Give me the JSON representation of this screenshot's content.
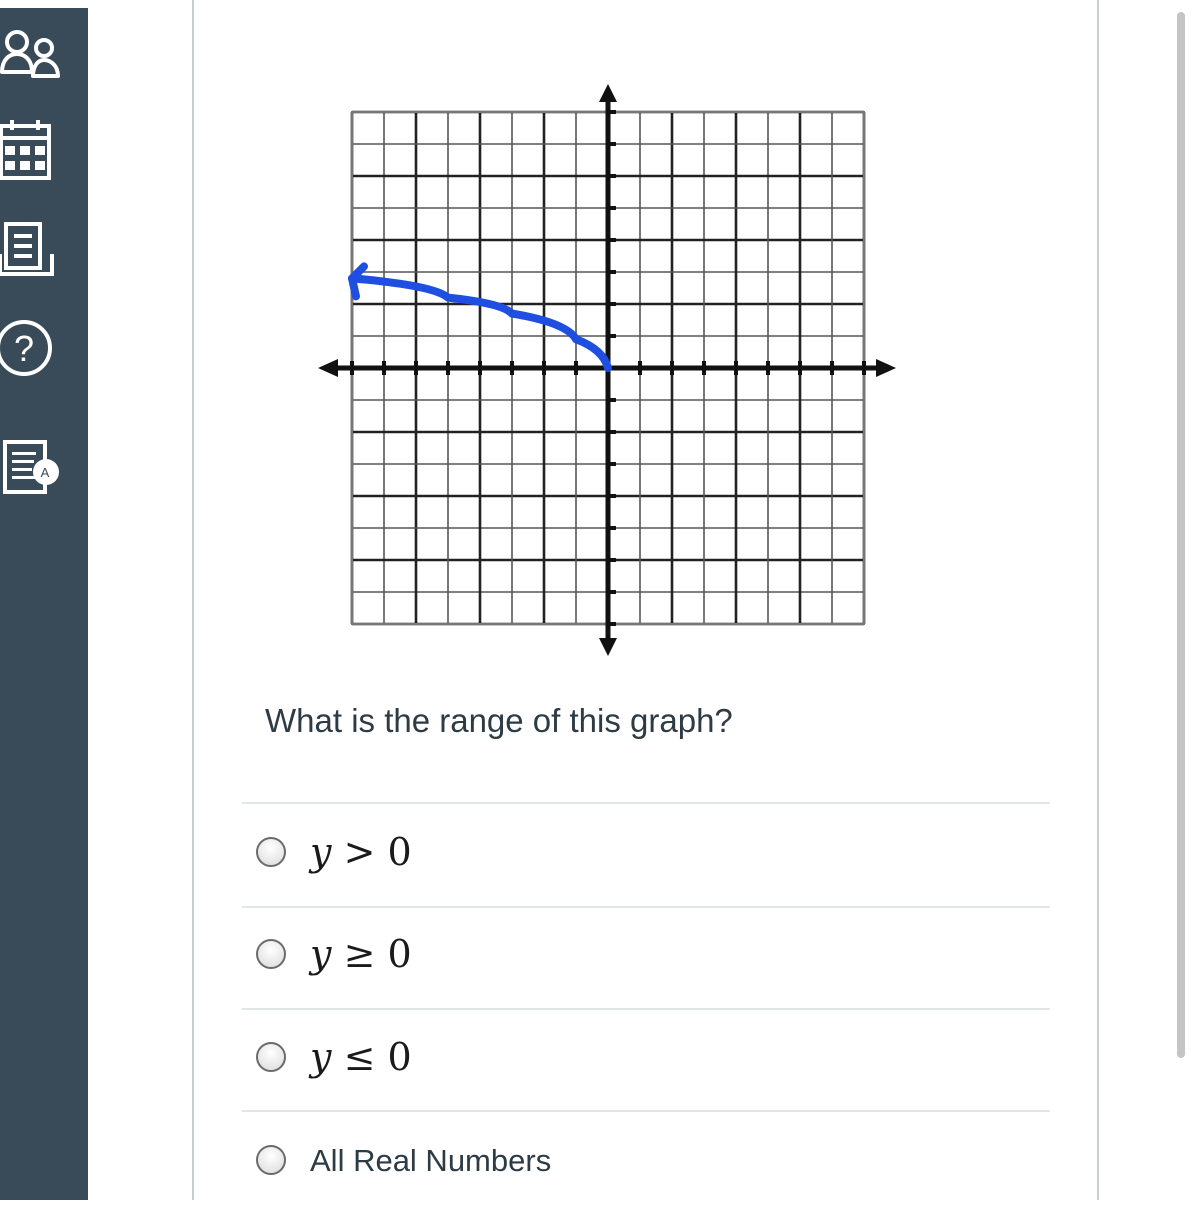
{
  "nav": {
    "items": [
      {
        "icon": "groups-icon"
      },
      {
        "icon": "calendar-icon"
      },
      {
        "icon": "inbox-icon"
      },
      {
        "icon": "help-icon"
      },
      {
        "icon": "assignment-icon"
      }
    ],
    "background": "#394b58"
  },
  "graph": {
    "grid_min": -8,
    "grid_max": 8,
    "curve_color": "#1f4fe0",
    "curve": {
      "type": "line",
      "points": [
        [
          0,
          0
        ],
        [
          -1,
          0.9
        ],
        [
          -3,
          1.7
        ],
        [
          -5,
          2.2
        ],
        [
          -8,
          2.8
        ]
      ],
      "arrow_end": "left"
    }
  },
  "question": {
    "prompt": "What is the range of this graph?"
  },
  "options": [
    {
      "var": "y",
      "op": ">",
      "val": "0"
    },
    {
      "var": "y",
      "op": "≥",
      "val": "0"
    },
    {
      "var": "y",
      "op": "≤",
      "val": "0"
    },
    {
      "text": "All Real Numbers"
    }
  ]
}
